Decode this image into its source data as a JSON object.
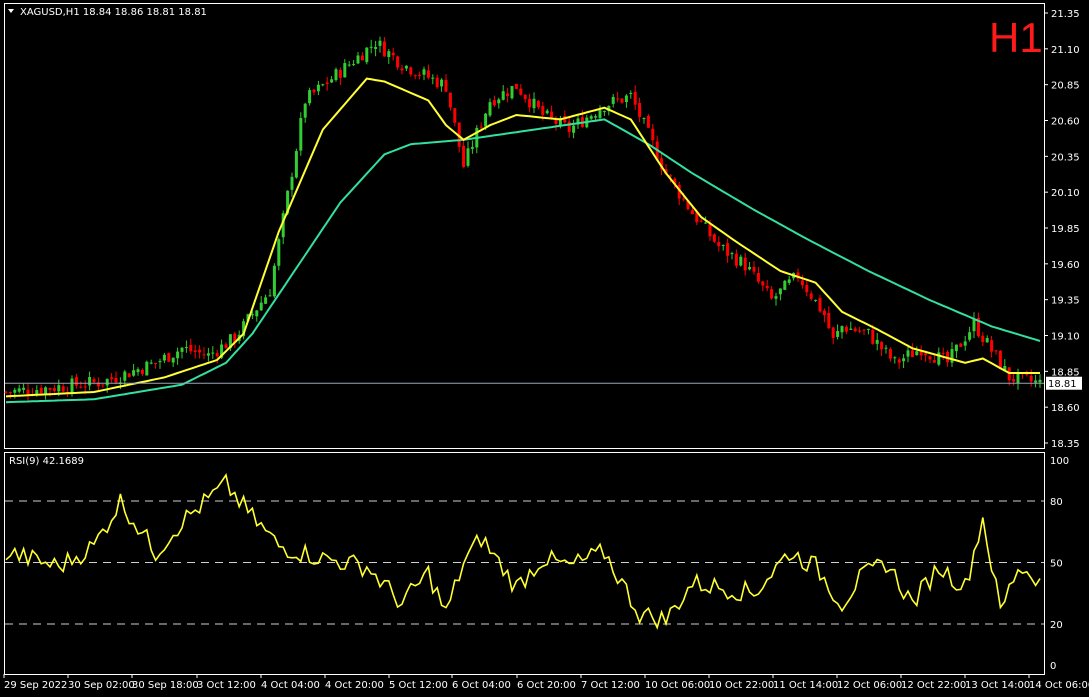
{
  "header": {
    "symbol_line": "XAGUSD,H1  18.84 18.86 18.81 18.81",
    "timeframe_badge": "H1",
    "rsi_label": "RSI(9) 42.1689",
    "current_price": "18.81"
  },
  "colors": {
    "background": "#000000",
    "bull": "#32cd32",
    "bear": "#ff0000",
    "ma_fast": "#ffff33",
    "ma_slow": "#33e0a0",
    "rsi": "#ffff33",
    "grid_frame": "#ffffff",
    "badge": "#ff1a1a"
  },
  "chart_data": [
    {
      "type": "candlestick",
      "title": "XAGUSD,H1",
      "series": [
        {
          "type": "candlestick"
        },
        {
          "type": "line"
        },
        {
          "type": "line"
        }
      ],
      "x_tick_labels": [
        "29 Sep 2022",
        "30 Sep 02:00",
        "30 Sep 18:00",
        "3 Oct 12:00",
        "4 Oct 04:00",
        "4 Oct 20:00",
        "5 Oct 12:00",
        "6 Oct 04:00",
        "6 Oct 20:00",
        "7 Oct 12:00",
        "10 Oct 06:00",
        "10 Oct 22:00",
        "11 Oct 14:00",
        "12 Oct 06:00",
        "12 Oct 22:00",
        "13 Oct 14:00",
        "14 Oct 06:00"
      ],
      "y_tick_labels": [
        "21.35",
        "21.10",
        "20.85",
        "20.60",
        "20.35",
        "20.10",
        "19.85",
        "19.60",
        "19.35",
        "19.10",
        "18.85",
        "18.60",
        "18.35"
      ],
      "ylim": [
        18.3,
        21.4
      ],
      "price_anchors": {
        "x": [
          0,
          10,
          22,
          34,
          40,
          46,
          52,
          60,
          68,
          76,
          84,
          90,
          100,
          104,
          110,
          116,
          122,
          128,
          136,
          142,
          150,
          156,
          162,
          168,
          174,
          180,
          186,
          188,
          190,
          196,
          202,
          208,
          214,
          220,
          228,
          235
        ],
        "close": [
          18.75,
          18.78,
          18.82,
          18.95,
          19.05,
          19.0,
          19.12,
          19.45,
          20.75,
          20.95,
          21.15,
          21.0,
          20.85,
          20.3,
          20.75,
          20.85,
          20.65,
          20.55,
          20.72,
          20.78,
          20.25,
          19.98,
          19.75,
          19.62,
          19.38,
          19.55,
          19.28,
          19.1,
          19.2,
          19.15,
          18.95,
          19.05,
          18.95,
          19.22,
          18.85,
          18.81
        ]
      },
      "ma_fast_anchors": {
        "x": [
          0,
          20,
          36,
          48,
          54,
          62,
          72,
          82,
          86,
          96,
          100,
          104,
          110,
          116,
          126,
          136,
          142,
          150,
          158,
          166,
          176,
          184,
          190,
          198,
          206,
          218,
          222,
          228,
          235
        ],
        "y": [
          18.72,
          18.75,
          18.85,
          18.97,
          19.15,
          19.85,
          20.55,
          20.9,
          20.88,
          20.75,
          20.58,
          20.48,
          20.58,
          20.65,
          20.62,
          20.7,
          20.62,
          20.25,
          19.95,
          19.78,
          19.58,
          19.5,
          19.3,
          19.18,
          19.05,
          18.95,
          18.98,
          18.88,
          18.88
        ]
      },
      "ma_slow_anchors": {
        "x": [
          0,
          20,
          40,
          50,
          56,
          66,
          76,
          86,
          92,
          104,
          120,
          136,
          146,
          156,
          170,
          182,
          196,
          210,
          224,
          235
        ],
        "y": [
          18.68,
          18.7,
          18.8,
          18.95,
          19.15,
          19.6,
          20.05,
          20.38,
          20.45,
          20.48,
          20.55,
          20.62,
          20.45,
          20.25,
          20.0,
          19.8,
          19.58,
          19.38,
          19.2,
          19.1
        ]
      }
    },
    {
      "type": "line",
      "title": "RSI(9) 42.1689",
      "series": [
        {
          "values_anchor_x": [
            0,
            12,
            20,
            26,
            34,
            40,
            50,
            56,
            62,
            72,
            82,
            90,
            96,
            100,
            104,
            108,
            116,
            122,
            128,
            136,
            144,
            150,
            156,
            162,
            170,
            178,
            184,
            190,
            194,
            200,
            206,
            212,
            218,
            222,
            226,
            230,
            235
          ],
          "values": [
            55,
            48,
            58,
            80,
            55,
            70,
            88,
            72,
            58,
            52,
            48,
            30,
            45,
            25,
            50,
            62,
            38,
            52,
            48,
            55,
            25,
            22,
            40,
            38,
            35,
            55,
            48,
            30,
            42,
            50,
            30,
            48,
            38,
            72,
            26,
            48,
            42
          ]
        }
      ],
      "ylim": [
        0,
        100
      ],
      "y_tick_labels": [
        "100",
        "80",
        "50",
        "20",
        "0"
      ],
      "levels": [
        80,
        50,
        20
      ]
    }
  ]
}
